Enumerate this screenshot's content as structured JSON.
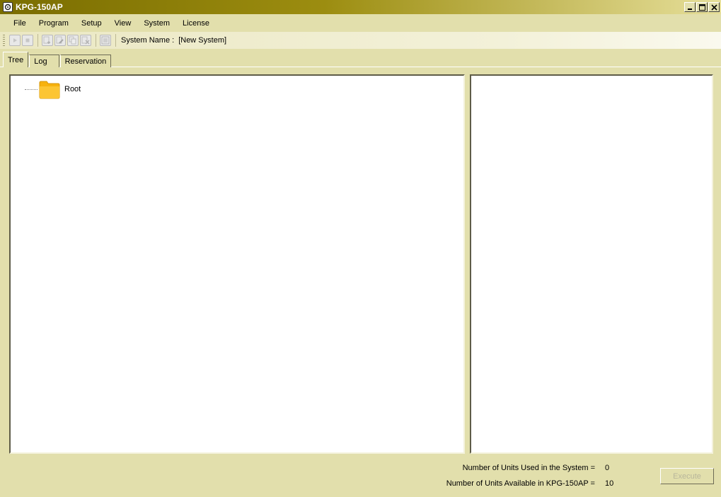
{
  "window": {
    "title": "KPG-150AP"
  },
  "menu": [
    "File",
    "Program",
    "Setup",
    "View",
    "System",
    "License"
  ],
  "toolbar": {
    "system_name_label": "System Name :",
    "system_name_value": "[New System]"
  },
  "tabs": [
    {
      "label": "Tree",
      "active": true
    },
    {
      "label": "Log",
      "active": false
    },
    {
      "label": "Reservation",
      "active": false
    }
  ],
  "tree": {
    "root_label": "Root"
  },
  "status": {
    "units_used_label": "Number of Units Used in the System =",
    "units_used_value": "0",
    "units_available_label": "Number of Units Available in KPG-150AP =",
    "units_available_value": "10"
  },
  "buttons": {
    "execute": "Execute"
  }
}
